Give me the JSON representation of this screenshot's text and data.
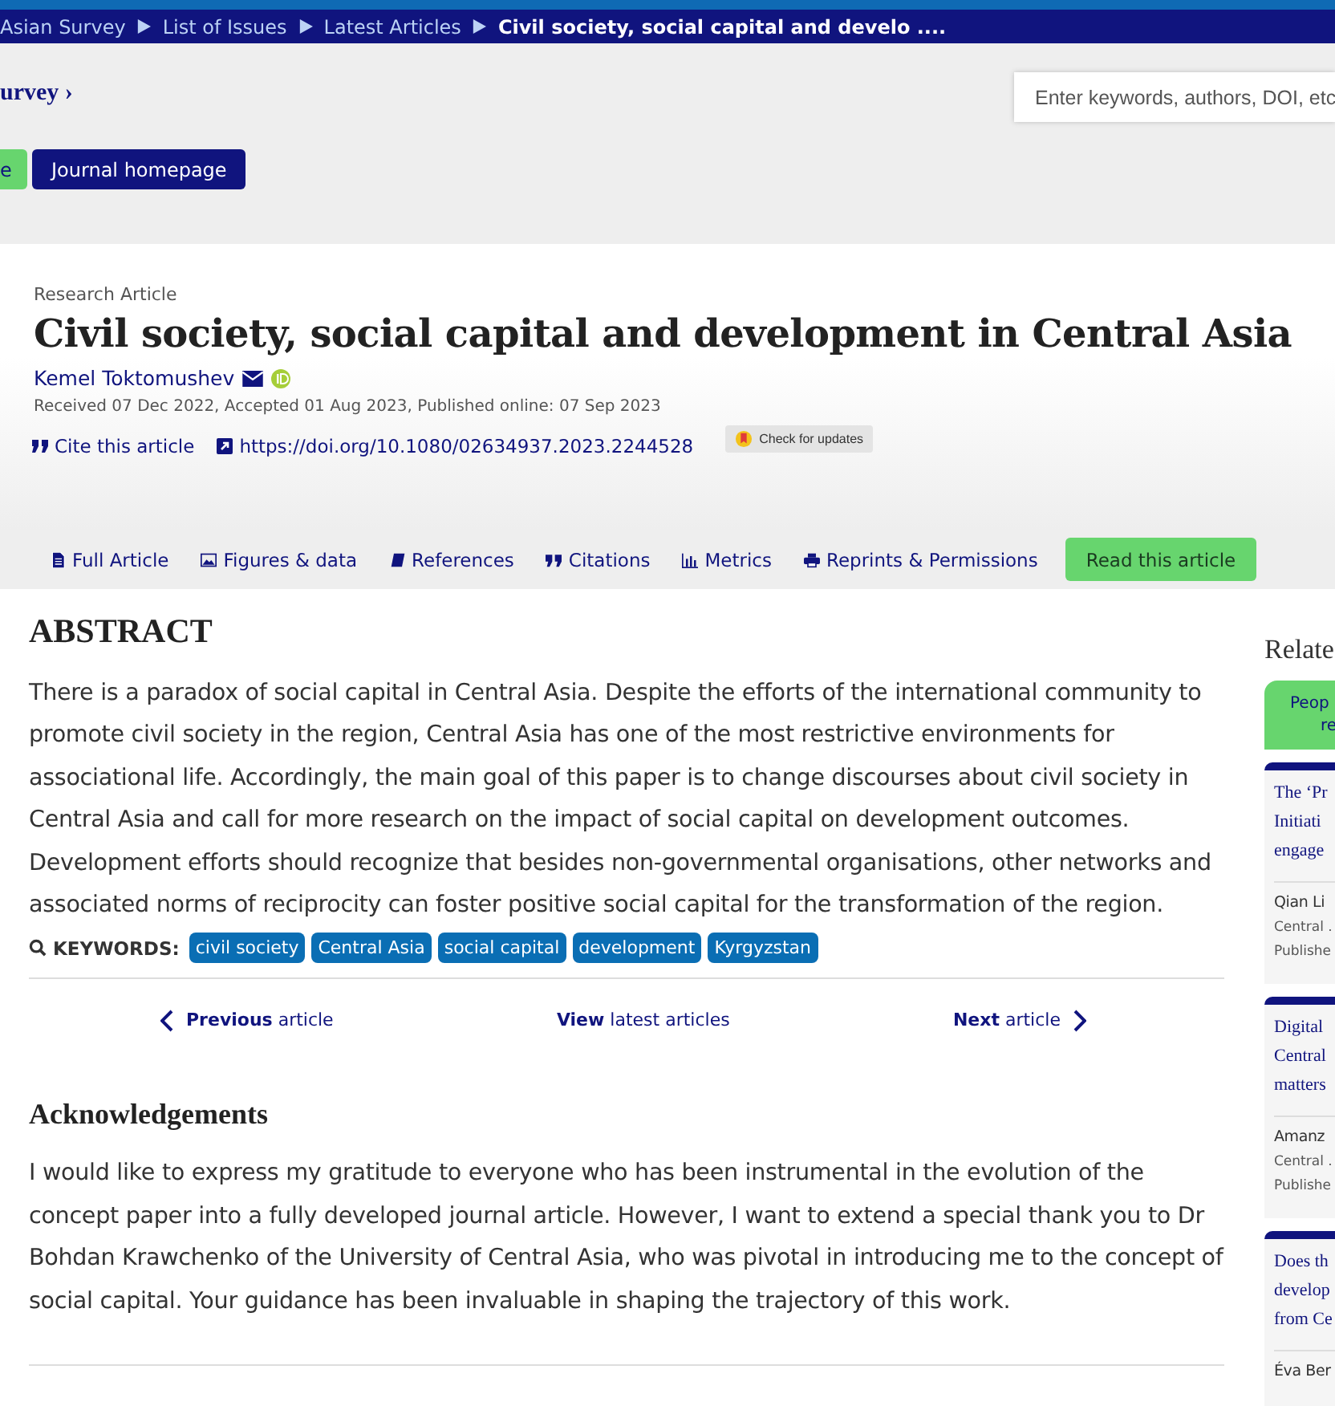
{
  "breadcrumbs": [
    {
      "label": "Asian Survey",
      "current": false
    },
    {
      "label": "List of Issues",
      "current": false
    },
    {
      "label": "Latest Articles",
      "current": false
    },
    {
      "label": "Civil society, social capital and develo ....",
      "current": true
    }
  ],
  "journal_link": "urvey ›",
  "search": {
    "placeholder": "Enter keywords, authors, DOI, etc"
  },
  "header_buttons": [
    {
      "label": "e",
      "kind": "green"
    },
    {
      "label": "Journal homepage",
      "kind": "navy"
    }
  ],
  "article": {
    "type": "Research Article",
    "title": "Civil society, social capital and development in Central Asia",
    "author": "Kemel Toktomushev",
    "dates": "Received 07 Dec 2022, Accepted 01 Aug 2023, Published online: 07 Sep 2023",
    "cite": "Cite this article",
    "doi": "https://doi.org/10.1080/02634937.2023.2244528",
    "updates": "Check for updates"
  },
  "tabs": [
    {
      "label": "Full Article",
      "kind": "doc"
    },
    {
      "label": "Figures & data",
      "kind": "image"
    },
    {
      "label": "References",
      "kind": "book"
    },
    {
      "label": "Citations",
      "kind": "quote"
    },
    {
      "label": "Metrics",
      "kind": "chart"
    },
    {
      "label": "Reprints & Permissions",
      "kind": "print"
    }
  ],
  "read_button": "Read this article",
  "abstract": {
    "heading": "ABSTRACT",
    "text": "There is a paradox of social capital in Central Asia. Despite the efforts of the international community to promote civil society in the region, Central Asia has one of the most restrictive environments for associational life. Accordingly, the main goal of this paper is to change discourses about civil society in Central Asia and call for more research on the impact of social capital on development outcomes. Development efforts should recognize that besides non-governmental organisations, other networks and associated norms of reciprocity can foster positive social capital for the transformation of the region."
  },
  "keywords": {
    "label": "KEYWORDS:",
    "items": [
      "civil society",
      "Central Asia",
      "social capital",
      "development",
      "Kyrgyzstan"
    ]
  },
  "article_nav": [
    {
      "bold": "Previous",
      "rest": "article",
      "kind": "prev"
    },
    {
      "bold": "View",
      "rest": "latest articles",
      "kind": "view"
    },
    {
      "bold": "Next",
      "rest": "article",
      "kind": "next"
    }
  ],
  "acknowledgements": {
    "heading": "Acknowledgements",
    "text": "I would like to express my gratitude to everyone who has been instrumental in the evolution of the concept paper into a fully developed journal article. However, I want to extend a special thank you to Dr Bohdan Krawchenko of the University of Central Asia, who was pivotal in introducing me to the concept of social capital. Your guidance has been invaluable in shaping the trajectory of this work."
  },
  "sidebar": {
    "heading": "Relate",
    "tab": [
      "Peop",
      "re"
    ],
    "cards": [
      {
        "title": [
          "The ‘Pr",
          "Initiati",
          "engage"
        ],
        "author": "Qian Li",
        "journal": "Central .",
        "published": "Publishe"
      },
      {
        "title": [
          "Digital",
          "Central",
          "matters"
        ],
        "author": "Amanz",
        "journal": "Central .",
        "published": "Publishe"
      },
      {
        "title": [
          "Does th",
          "develop",
          "from Ce"
        ],
        "author": "Éva Ber"
      }
    ]
  }
}
